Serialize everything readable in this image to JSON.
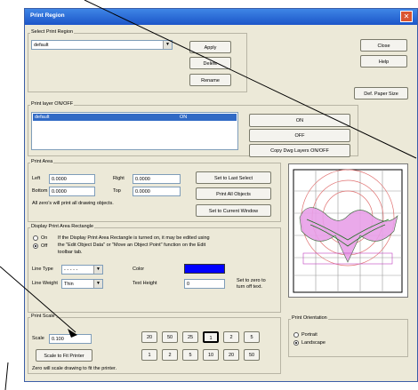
{
  "window": {
    "title": "Print Region"
  },
  "select_region": {
    "group_label": "Select Print Region",
    "value": "default",
    "apply_label": "Apply",
    "delete_label": "Delete",
    "rename_label": "Rename"
  },
  "side": {
    "close_label": "Close",
    "help_label": "Help",
    "paper_size_label": "Def. Paper Size"
  },
  "layers": {
    "group_label": "Print layer ON/OFF",
    "row_name": "default",
    "row_state": "ON",
    "on_label": "ON",
    "off_label": "OFF",
    "copy_label": "Copy Dwg Layers ON/OFF"
  },
  "area": {
    "group_label": "Print Area",
    "left_label": "Left",
    "left_value": "0.0000",
    "right_label": "Right",
    "right_value": "0.0000",
    "bottom_label": "Bottom",
    "bottom_value": "0.0000",
    "top_label": "Top",
    "top_value": "0.0000",
    "note": "All zero's will print all drawing objects.",
    "last_select_label": "Set to Last Select",
    "print_all_label": "Print All Objects",
    "current_window_label": "Set to Current Window"
  },
  "rect": {
    "group_label": "Display Print Area Rectangle",
    "on_label": "On",
    "off_label": "Off",
    "info_line1": "If the Display Print Area Rectangle is turned on, it may be edited using",
    "info_line2": "the \"Edit Object Data\" or \"Move an Object Point\" function on the Edit",
    "info_line3": "toolbar tab.",
    "line_type_label": "Line Type",
    "line_type_value": "- - - - -",
    "color_label": "Color",
    "color_hex": "#0000ff",
    "line_weight_label": "Line Weight",
    "line_weight_value": "Thin",
    "text_height_label": "Text Height",
    "text_height_value": "0",
    "set_zero_line1": "Set to zero to",
    "set_zero_line2": "turn off text."
  },
  "scale": {
    "group_label": "Print Scale",
    "scale_label": "Scale",
    "scale_value": "0.100",
    "fit_label": "Scale to Fit Printer",
    "note": "Zero will scale drawing to fit the printer.",
    "row1": [
      "20",
      "50",
      "25",
      "1",
      "2",
      "5"
    ],
    "row2": [
      "1",
      "2",
      "5",
      "10",
      "20",
      "50"
    ]
  },
  "orientation": {
    "group_label": "Print Orientation",
    "portrait_label": "Portrait",
    "landscape_label": "Landscape"
  },
  "colors": {
    "title_bar": "#1c55c8",
    "list_selection": "#316ac5",
    "annotation_arrow": "#000000"
  }
}
